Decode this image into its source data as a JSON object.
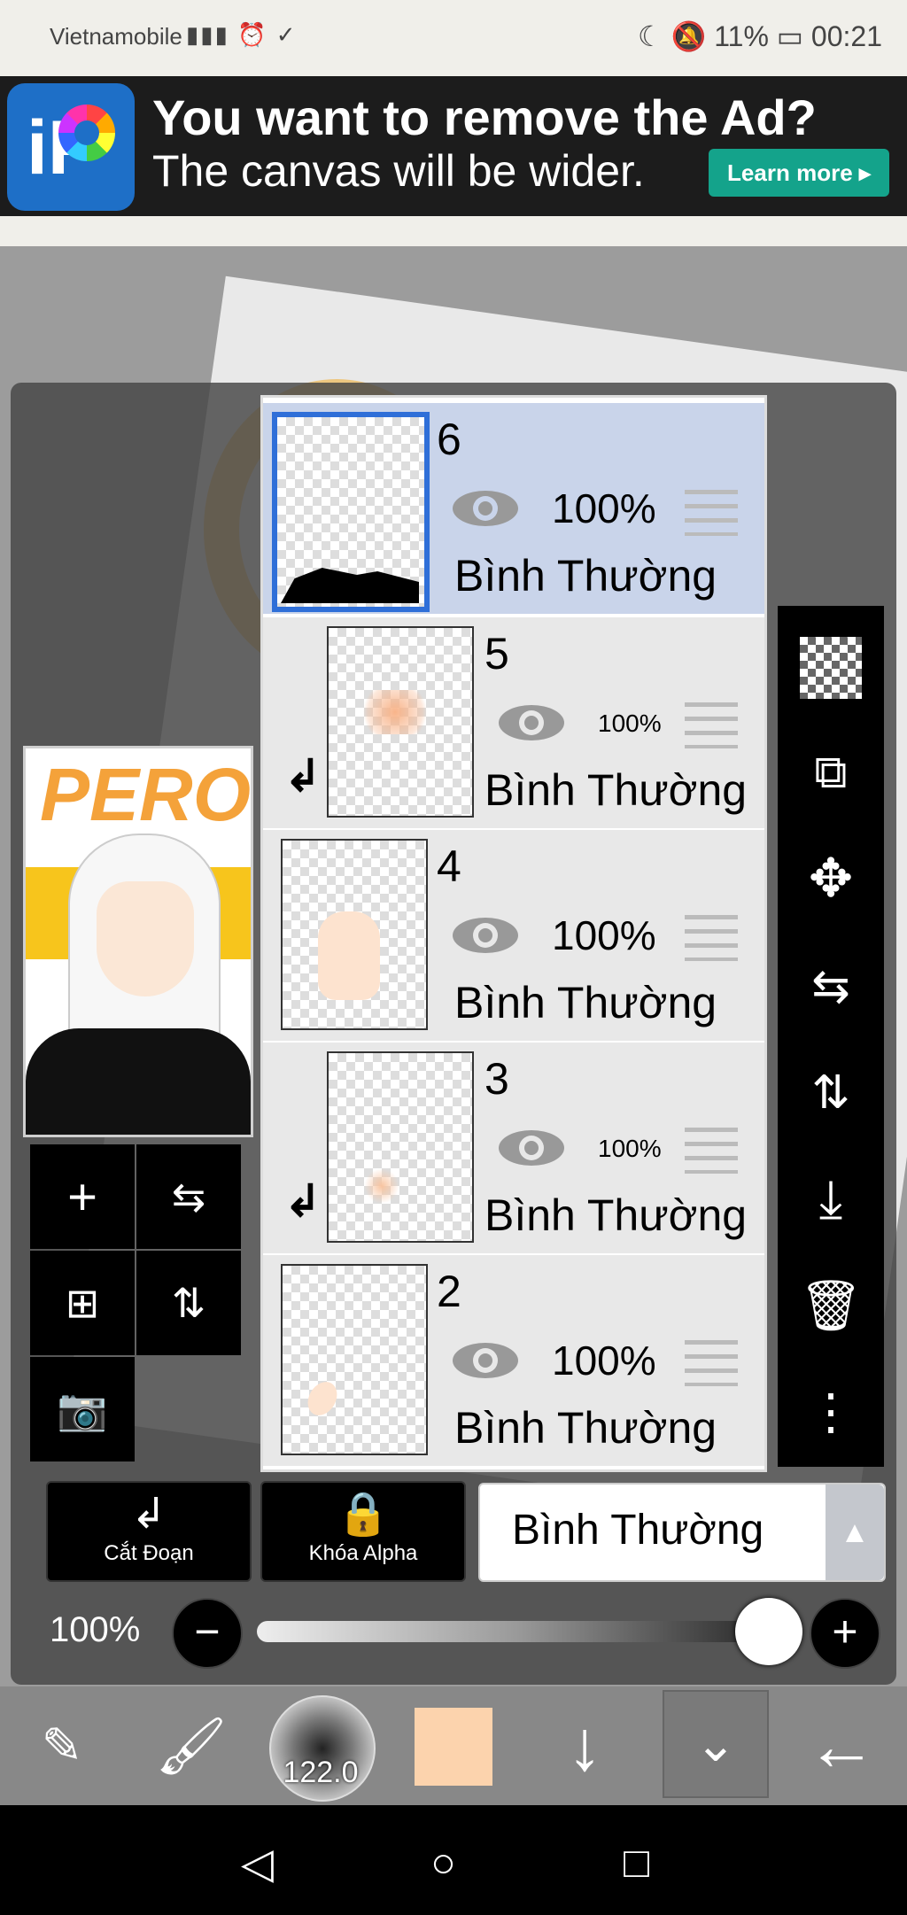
{
  "status_bar": {
    "carrier": "Vietnamobile",
    "battery": "11%",
    "time": "00:21"
  },
  "ad": {
    "logo_text": "iP",
    "headline": "You want to remove the Ad?",
    "subline": "The canvas will be wider.",
    "cta": "Learn more ▸"
  },
  "preview": {
    "text": "PERO"
  },
  "layers": [
    {
      "number": "6",
      "opacity": "100%",
      "blend": "Bình Thường",
      "selected": true,
      "clipped": false
    },
    {
      "number": "5",
      "opacity": "100%",
      "blend": "Bình Thường",
      "selected": false,
      "clipped": true
    },
    {
      "number": "4",
      "opacity": "100%",
      "blend": "Bình Thường",
      "selected": false,
      "clipped": false
    },
    {
      "number": "3",
      "opacity": "100%",
      "blend": "Bình Thường",
      "selected": false,
      "clipped": true
    },
    {
      "number": "2",
      "opacity": "100%",
      "blend": "Bình Thường",
      "selected": false,
      "clipped": false
    }
  ],
  "layer_controls": {
    "clip_label": "Cắt Đoạn",
    "alpha_lock_label": "Khóa Alpha",
    "blend_mode": "Bình Thường"
  },
  "opacity": {
    "label": "100%",
    "value": 1.0
  },
  "toolbar": {
    "brush_size": "122.0",
    "color": "#fcd3ad"
  },
  "colors": {
    "selected_layer_bg": "#c9d4ea",
    "selected_border": "#2f6fd8",
    "learn_more_bg": "#14a38b"
  }
}
